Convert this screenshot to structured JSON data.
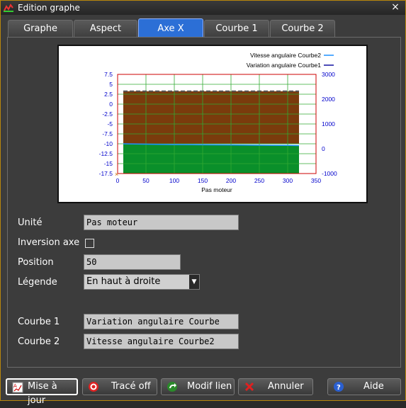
{
  "window": {
    "title": "Edition graphe",
    "close_symbol": "×"
  },
  "tabs": [
    {
      "label": "Graphe",
      "active": false
    },
    {
      "label": "Aspect",
      "active": false
    },
    {
      "label": "Axe X",
      "active": true
    },
    {
      "label": "Courbe 1",
      "active": false
    },
    {
      "label": "Courbe 2",
      "active": false
    }
  ],
  "form": {
    "unit_label": "Unité",
    "unit_value": "Pas moteur",
    "inversion_label": "Inversion axe",
    "inversion_checked": false,
    "position_label": "Position",
    "position_value": "50",
    "legend_label": "Légende",
    "legend_value": "En haut à droite",
    "curve1_label": "Courbe 1",
    "curve1_value": "Variation angulaire Courbe",
    "curve2_label": "Courbe 2",
    "curve2_value": "Vitesse angulaire Courbe2"
  },
  "buttons": {
    "update": "Mise à jour",
    "trace_off": "Tracé off",
    "modif_lien": "Modif lien",
    "cancel": "Annuler",
    "help": "Aide"
  },
  "chart_data": {
    "type": "line",
    "xlabel": "Pas moteur",
    "xlim": [
      0,
      350
    ],
    "xticks": [
      0,
      50,
      100,
      150,
      200,
      250,
      300,
      350
    ],
    "ylim_left": [
      -17.5,
      7.5
    ],
    "yticks_left": [
      7.5,
      5,
      2.5,
      0,
      -2.5,
      -5,
      -7.5,
      -10,
      -12.5,
      -15,
      -17.5
    ],
    "ylim_right": [
      -1000,
      3000
    ],
    "yticks_right": [
      3000,
      2000,
      1000,
      0,
      -1000
    ],
    "legend_position": "top-right",
    "grid": true,
    "series": [
      {
        "name": "Vitesse angulaire Courbe2",
        "axis": "right",
        "color": "#1e90ff",
        "x": [
          10,
          50,
          100,
          150,
          200,
          250,
          300,
          320
        ],
        "y": [
          2320,
          2320,
          2320,
          2320,
          2320,
          2320,
          2320,
          2320
        ],
        "fill": "#7a3b0c"
      },
      {
        "name": "Variation angulaire Courbe1",
        "axis": "left",
        "color": "#1010a0",
        "x": [
          10,
          50,
          100,
          150,
          200,
          250,
          300,
          320
        ],
        "y": [
          -10.0,
          -10.1,
          -10.2,
          -10.25,
          -10.3,
          -10.35,
          -10.4,
          -10.45
        ],
        "fill": "#0a8f2a"
      }
    ],
    "colors": {
      "left_axis": "#0000cc",
      "right_axis": "#0000cc",
      "grid": "#33aa33",
      "frame": "#cc0000"
    }
  }
}
